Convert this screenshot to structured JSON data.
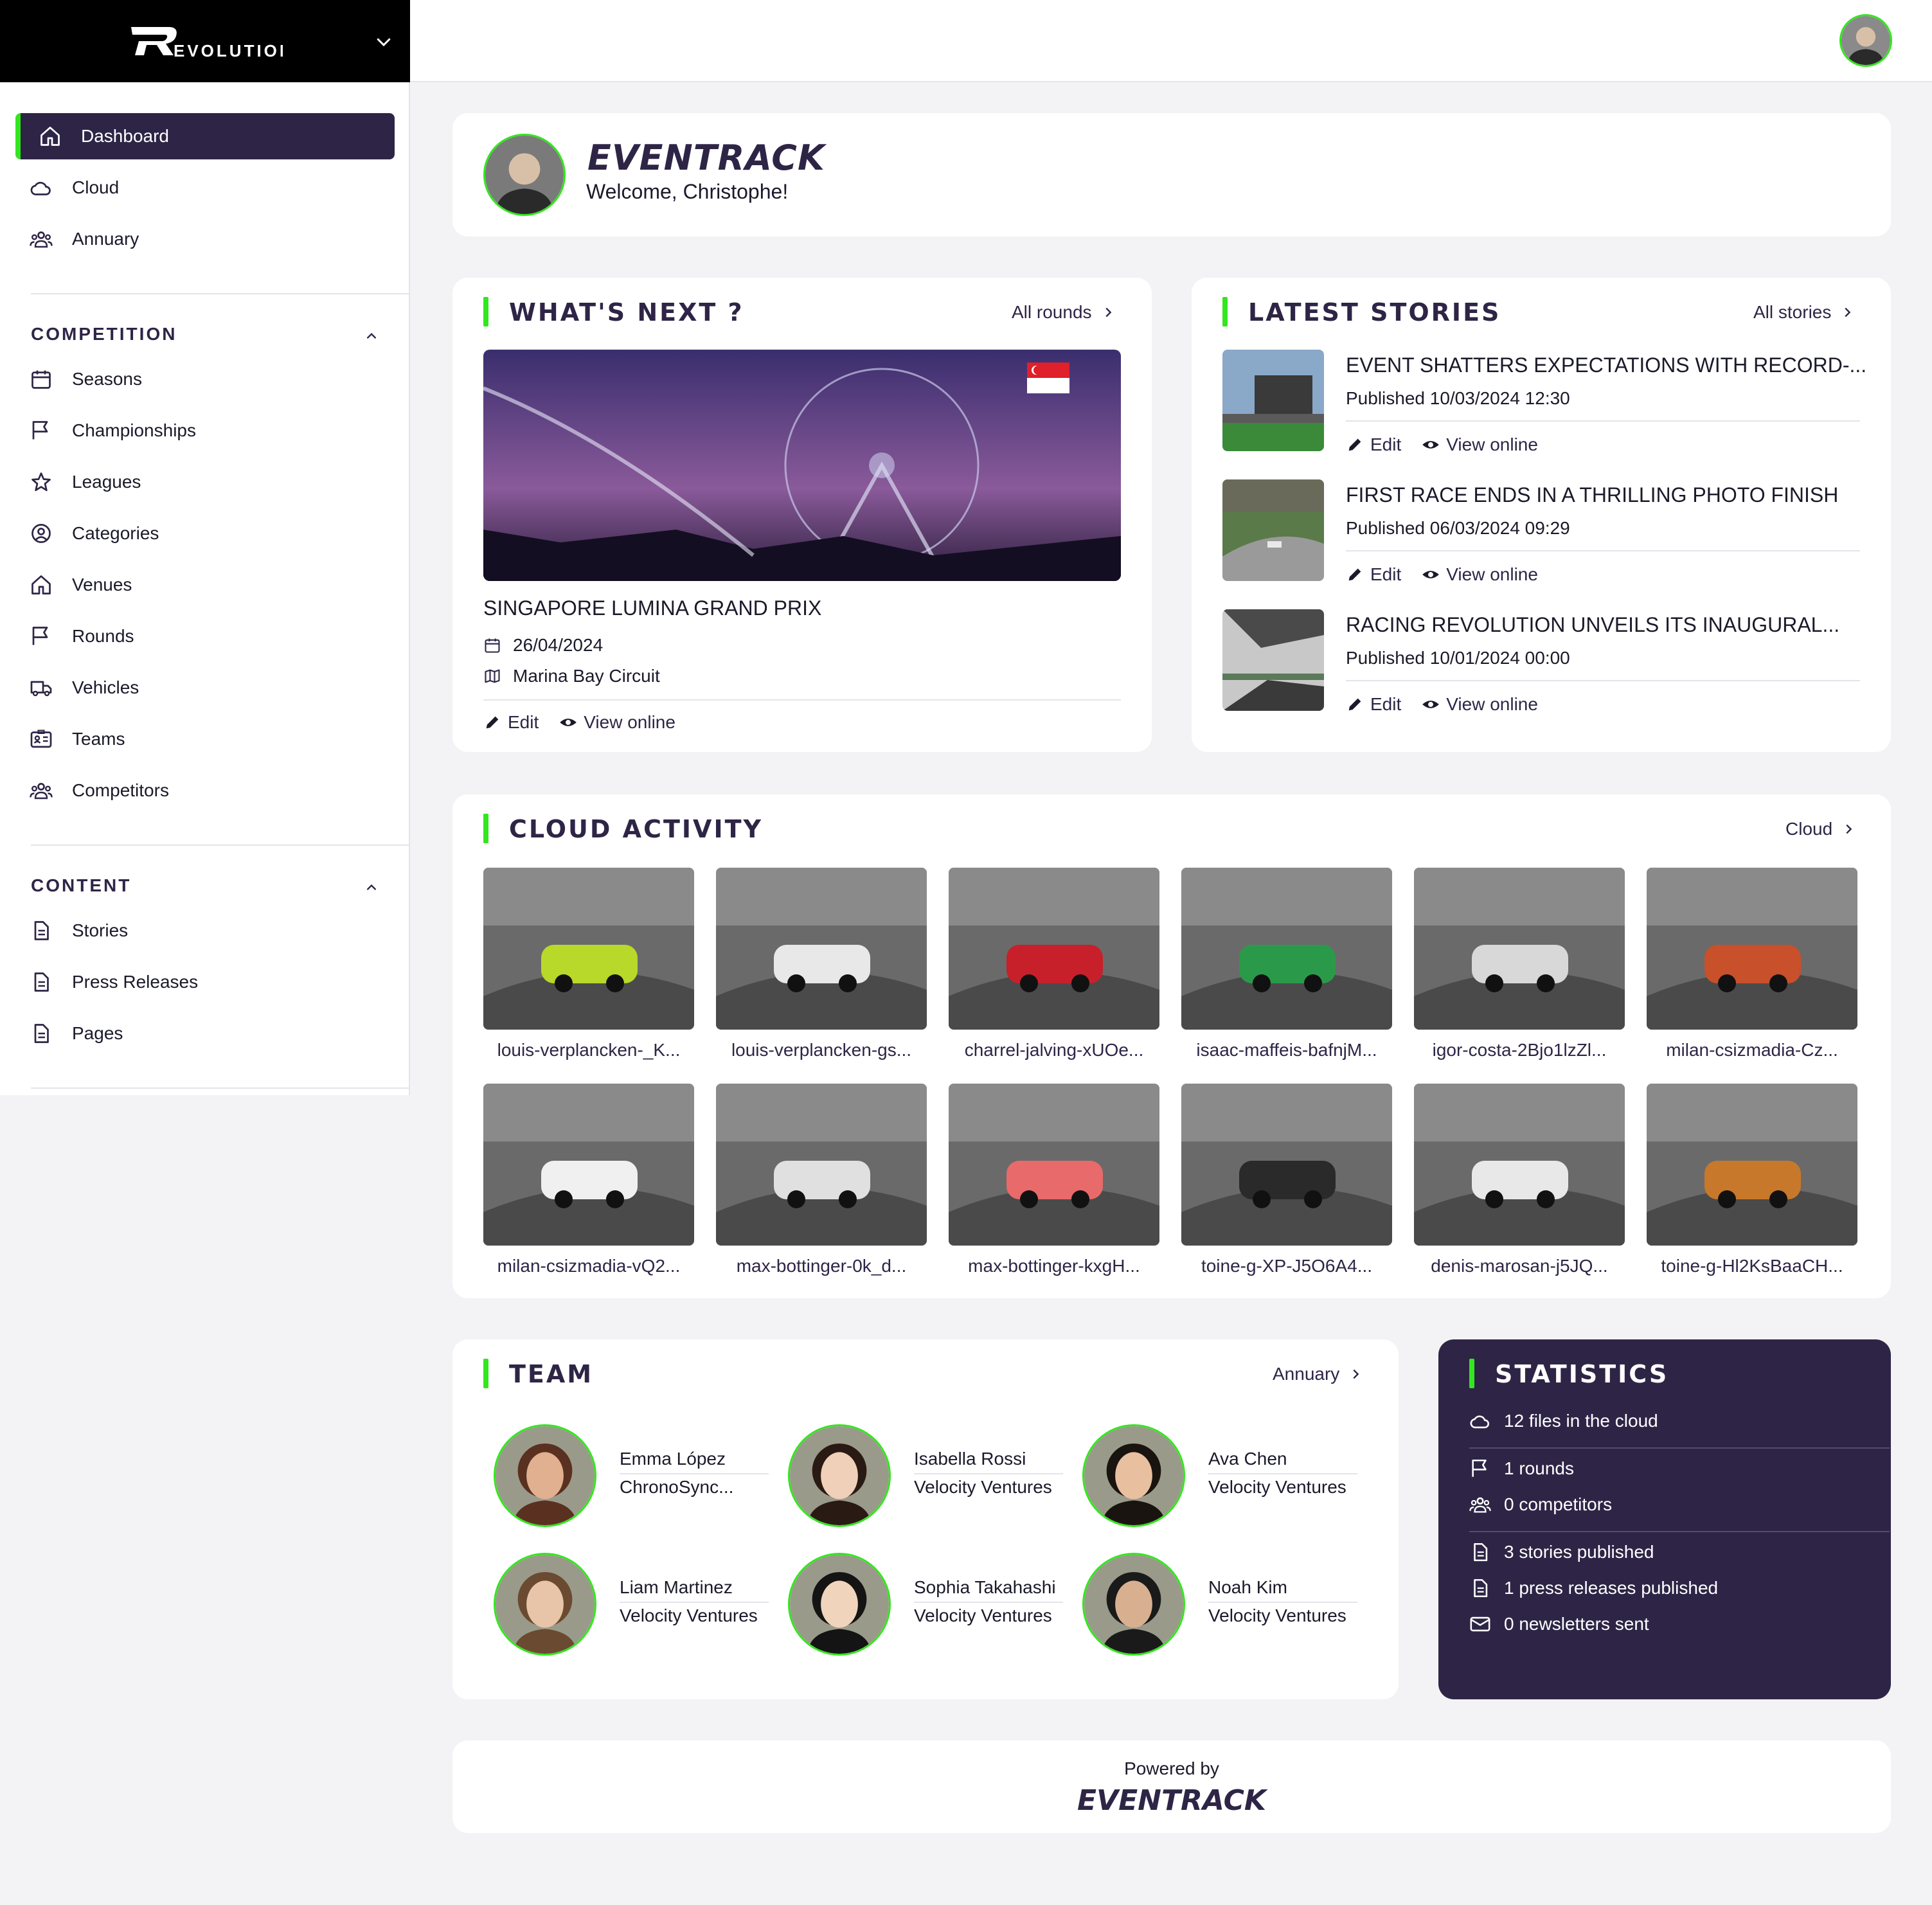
{
  "brand": {
    "name": "EVOLUTION"
  },
  "sidebar": {
    "main": [
      {
        "label": "Dashboard",
        "icon": "home-icon",
        "active": true
      },
      {
        "label": "Cloud",
        "icon": "cloud-icon"
      },
      {
        "label": "Annuary",
        "icon": "users-icon"
      }
    ],
    "competition": {
      "title": "COMPETITION",
      "items": [
        {
          "label": "Seasons",
          "icon": "calendar-icon"
        },
        {
          "label": "Championships",
          "icon": "flag-icon"
        },
        {
          "label": "Leagues",
          "icon": "star-icon"
        },
        {
          "label": "Categories",
          "icon": "user-circle-icon"
        },
        {
          "label": "Venues",
          "icon": "home-icon"
        },
        {
          "label": "Rounds",
          "icon": "flag-icon"
        },
        {
          "label": "Vehicles",
          "icon": "truck-icon"
        },
        {
          "label": "Teams",
          "icon": "id-card-icon"
        },
        {
          "label": "Competitors",
          "icon": "users-icon"
        }
      ]
    },
    "content": {
      "title": "CONTENT",
      "items": [
        {
          "label": "Stories",
          "icon": "document-icon"
        },
        {
          "label": "Press Releases",
          "icon": "document-icon"
        },
        {
          "label": "Pages",
          "icon": "document-icon"
        }
      ]
    }
  },
  "welcome": {
    "logo": "EVENTRACK",
    "text": "Welcome, Christophe!"
  },
  "whats_next": {
    "title": "WHAT'S NEXT ?",
    "link": "All rounds",
    "event_name": "SINGAPORE LUMINA GRAND PRIX",
    "date": "26/04/2024",
    "venue": "Marina Bay Circuit",
    "edit": "Edit",
    "view": "View online"
  },
  "stories": {
    "title": "LATEST STORIES",
    "link": "All stories",
    "items": [
      {
        "title": "EVENT SHATTERS EXPECTATIONS WITH RECORD-...",
        "published": "Published 10/03/2024 12:30"
      },
      {
        "title": "FIRST RACE ENDS IN A THRILLING PHOTO FINISH",
        "published": "Published 06/03/2024 09:29"
      },
      {
        "title": "RACING REVOLUTION UNVEILS ITS INAUGURAL...",
        "published": "Published 10/01/2024 00:00"
      }
    ],
    "edit": "Edit",
    "view": "View online"
  },
  "cloud": {
    "title": "CLOUD ACTIVITY",
    "link": "Cloud",
    "files": [
      {
        "name": "louis-verplancken-_K...",
        "color": "#b8d82a"
      },
      {
        "name": "louis-verplancken-gs...",
        "color": "#e8e8e8"
      },
      {
        "name": "charrel-jalving-xUOe...",
        "color": "#c8202a"
      },
      {
        "name": "isaac-maffeis-bafnjM...",
        "color": "#2a9a4a"
      },
      {
        "name": "igor-costa-2Bjo1lzZl...",
        "color": "#d8d8d8"
      },
      {
        "name": "milan-csizmadia-Cz...",
        "color": "#c8502a"
      },
      {
        "name": "milan-csizmadia-vQ2...",
        "color": "#f0f0f0"
      },
      {
        "name": "max-bottinger-0k_d...",
        "color": "#e0e0e0"
      },
      {
        "name": "max-bottinger-kxgH...",
        "color": "#e86a6a"
      },
      {
        "name": "toine-g-XP-J5O6A4...",
        "color": "#2a2a2a"
      },
      {
        "name": "denis-marosan-j5JQ...",
        "color": "#e8e8e8"
      },
      {
        "name": "toine-g-Hl2KsBaaCH...",
        "color": "#c8782a"
      }
    ]
  },
  "team": {
    "title": "TEAM",
    "link": "Annuary",
    "members": [
      {
        "name": "Emma López",
        "team": "ChronoSync..."
      },
      {
        "name": "Isabella Rossi",
        "team": "Velocity Ventures"
      },
      {
        "name": "Ava Chen",
        "team": "Velocity Ventures"
      },
      {
        "name": "Liam Martinez",
        "team": "Velocity Ventures"
      },
      {
        "name": "Sophia Takahashi",
        "team": "Velocity Ventures"
      },
      {
        "name": "Noah Kim",
        "team": "Velocity Ventures"
      }
    ]
  },
  "statistics": {
    "title": "STATISTICS",
    "files": "12 files in the cloud",
    "rounds": "1 rounds",
    "competitors": "0 competitors",
    "stories": "3 stories published",
    "press": "1 press releases published",
    "newsletters": "0 newsletters sent"
  },
  "footer": {
    "powered_by": "Powered by",
    "logo": "EVENTRACK"
  },
  "colors": {
    "accent": "#33e61f",
    "navy": "#2e2546"
  }
}
